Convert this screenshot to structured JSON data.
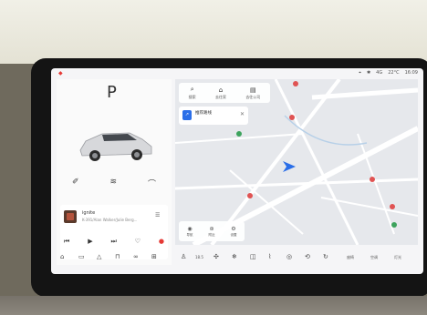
{
  "status": {
    "items": [
      "4G",
      "22°C",
      "16:09"
    ]
  },
  "cluster": {
    "gear": "P"
  },
  "music": {
    "song": "ignite",
    "artist": "K-391/Alan Walker/Julie Berg..."
  },
  "map": {
    "search_label": "搜索",
    "home_label": "去往家",
    "company_label": "去往公司",
    "card_title": "推荐路线",
    "card_sub": "",
    "btns": [
      "导航",
      "附近",
      "设置"
    ]
  },
  "dock": {
    "temp": "18.5",
    "right_labels": [
      "座椅",
      "空调",
      "灯光"
    ]
  }
}
